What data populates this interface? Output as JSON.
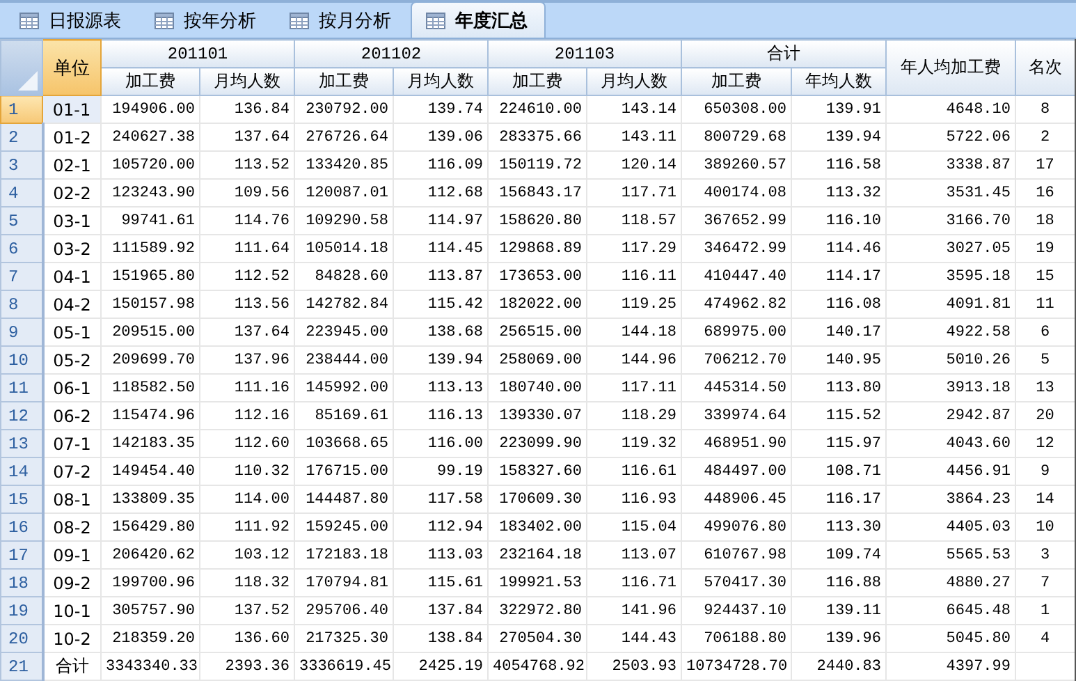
{
  "tabs": [
    {
      "label": "日报源表",
      "selected": false
    },
    {
      "label": "按年分析",
      "selected": false
    },
    {
      "label": "按月分析",
      "selected": false
    },
    {
      "label": "年度汇总",
      "selected": true
    }
  ],
  "table": {
    "unit_header": {
      "label": "单位",
      "selected": true
    },
    "groups": [
      {
        "label": "201101",
        "subheaders": [
          "加工费",
          "月均人数"
        ]
      },
      {
        "label": "201102",
        "subheaders": [
          "加工费",
          "月均人数"
        ]
      },
      {
        "label": "201103",
        "subheaders": [
          "加工费",
          "月均人数"
        ]
      },
      {
        "label": "合计",
        "subheaders": [
          "加工费",
          "年均人数"
        ]
      }
    ],
    "trailing_headers": [
      "年人均加工费",
      "名次"
    ],
    "rows": [
      {
        "number": "1",
        "selected": true,
        "unit": "01-1",
        "values": [
          "194906.00",
          "136.84",
          "230792.00",
          "139.74",
          "224610.00",
          "143.14",
          "650308.00",
          "139.91",
          "4648.10",
          "8"
        ]
      },
      {
        "number": "2",
        "selected": false,
        "unit": "01-2",
        "values": [
          "240627.38",
          "137.64",
          "276726.64",
          "139.06",
          "283375.66",
          "143.11",
          "800729.68",
          "139.94",
          "5722.06",
          "2"
        ]
      },
      {
        "number": "3",
        "selected": false,
        "unit": "02-1",
        "values": [
          "105720.00",
          "113.52",
          "133420.85",
          "116.09",
          "150119.72",
          "120.14",
          "389260.57",
          "116.58",
          "3338.87",
          "17"
        ]
      },
      {
        "number": "4",
        "selected": false,
        "unit": "02-2",
        "values": [
          "123243.90",
          "109.56",
          "120087.01",
          "112.68",
          "156843.17",
          "117.71",
          "400174.08",
          "113.32",
          "3531.45",
          "16"
        ]
      },
      {
        "number": "5",
        "selected": false,
        "unit": "03-1",
        "values": [
          "99741.61",
          "114.76",
          "109290.58",
          "114.97",
          "158620.80",
          "118.57",
          "367652.99",
          "116.10",
          "3166.70",
          "18"
        ]
      },
      {
        "number": "6",
        "selected": false,
        "unit": "03-2",
        "values": [
          "111589.92",
          "111.64",
          "105014.18",
          "114.45",
          "129868.89",
          "117.29",
          "346472.99",
          "114.46",
          "3027.05",
          "19"
        ]
      },
      {
        "number": "7",
        "selected": false,
        "unit": "04-1",
        "values": [
          "151965.80",
          "112.52",
          "84828.60",
          "113.87",
          "173653.00",
          "116.11",
          "410447.40",
          "114.17",
          "3595.18",
          "15"
        ]
      },
      {
        "number": "8",
        "selected": false,
        "unit": "04-2",
        "values": [
          "150157.98",
          "113.56",
          "142782.84",
          "115.42",
          "182022.00",
          "119.25",
          "474962.82",
          "116.08",
          "4091.81",
          "11"
        ]
      },
      {
        "number": "9",
        "selected": false,
        "unit": "05-1",
        "values": [
          "209515.00",
          "137.64",
          "223945.00",
          "138.68",
          "256515.00",
          "144.18",
          "689975.00",
          "140.17",
          "4922.58",
          "6"
        ]
      },
      {
        "number": "10",
        "selected": false,
        "unit": "05-2",
        "values": [
          "209699.70",
          "137.96",
          "238444.00",
          "139.94",
          "258069.00",
          "144.96",
          "706212.70",
          "140.95",
          "5010.26",
          "5"
        ]
      },
      {
        "number": "11",
        "selected": false,
        "unit": "06-1",
        "values": [
          "118582.50",
          "111.16",
          "145992.00",
          "113.13",
          "180740.00",
          "117.11",
          "445314.50",
          "113.80",
          "3913.18",
          "13"
        ]
      },
      {
        "number": "12",
        "selected": false,
        "unit": "06-2",
        "values": [
          "115474.96",
          "112.16",
          "85169.61",
          "116.13",
          "139330.07",
          "118.29",
          "339974.64",
          "115.52",
          "2942.87",
          "20"
        ]
      },
      {
        "number": "13",
        "selected": false,
        "unit": "07-1",
        "values": [
          "142183.35",
          "112.60",
          "103668.65",
          "116.00",
          "223099.90",
          "119.32",
          "468951.90",
          "115.97",
          "4043.60",
          "12"
        ]
      },
      {
        "number": "14",
        "selected": false,
        "unit": "07-2",
        "values": [
          "149454.40",
          "110.32",
          "176715.00",
          "99.19",
          "158327.60",
          "116.61",
          "484497.00",
          "108.71",
          "4456.91",
          "9"
        ]
      },
      {
        "number": "15",
        "selected": false,
        "unit": "08-1",
        "values": [
          "133809.35",
          "114.00",
          "144487.80",
          "117.58",
          "170609.30",
          "116.93",
          "448906.45",
          "116.17",
          "3864.23",
          "14"
        ]
      },
      {
        "number": "16",
        "selected": false,
        "unit": "08-2",
        "values": [
          "156429.80",
          "111.92",
          "159245.00",
          "112.94",
          "183402.00",
          "115.04",
          "499076.80",
          "113.30",
          "4405.03",
          "10"
        ]
      },
      {
        "number": "17",
        "selected": false,
        "unit": "09-1",
        "values": [
          "206420.62",
          "103.12",
          "172183.18",
          "113.03",
          "232164.18",
          "113.07",
          "610767.98",
          "109.74",
          "5565.53",
          "3"
        ]
      },
      {
        "number": "18",
        "selected": false,
        "unit": "09-2",
        "values": [
          "199700.96",
          "118.32",
          "170794.81",
          "115.61",
          "199921.53",
          "116.71",
          "570417.30",
          "116.88",
          "4880.27",
          "7"
        ]
      },
      {
        "number": "19",
        "selected": false,
        "unit": "10-1",
        "values": [
          "305757.90",
          "137.52",
          "295706.40",
          "137.84",
          "322972.80",
          "141.96",
          "924437.10",
          "139.11",
          "6645.48",
          "1"
        ]
      },
      {
        "number": "20",
        "selected": false,
        "unit": "10-2",
        "values": [
          "218359.20",
          "136.60",
          "217325.30",
          "138.84",
          "270504.30",
          "144.43",
          "706188.80",
          "139.96",
          "5045.80",
          "4"
        ]
      },
      {
        "number": "21",
        "selected": false,
        "unit": "合计",
        "values": [
          "3343340.33",
          "2393.36",
          "3336619.45",
          "2425.19",
          "4054768.92",
          "2503.93",
          "10734728.70",
          "2440.83",
          "4397.99"
        ]
      }
    ]
  }
}
